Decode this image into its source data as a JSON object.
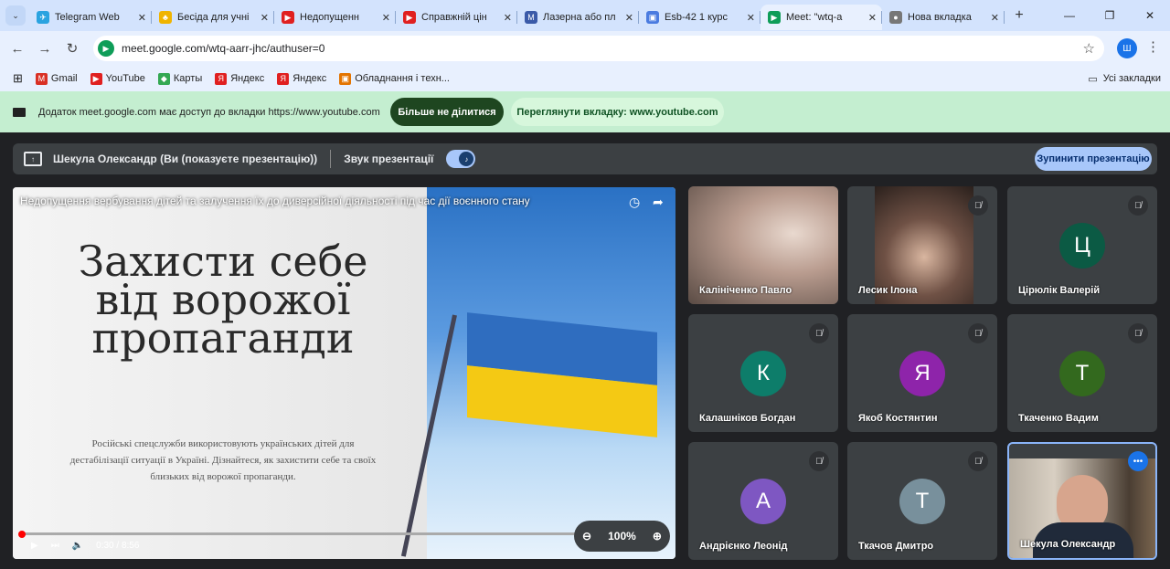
{
  "tabs": [
    {
      "title": "Telegram Web",
      "color": "#2aa3e0",
      "glyph": "✈"
    },
    {
      "title": "Бесіда для учні",
      "color": "#f0b400",
      "glyph": "♣"
    },
    {
      "title": "Недопущенн",
      "color": "#e02020",
      "glyph": "▶"
    },
    {
      "title": "Справжній цін",
      "color": "#e02020",
      "glyph": "▶"
    },
    {
      "title": "Лазерна або пл",
      "color": "#3a5aa8",
      "glyph": "M"
    },
    {
      "title": "Esb-42 1 курс",
      "color": "#4a7be0",
      "glyph": "▣"
    },
    {
      "title": "Meet: \"wtq-a",
      "color": "#0f9d58",
      "glyph": "▶"
    },
    {
      "title": "Нова вкладка",
      "color": "#777777",
      "glyph": "●"
    }
  ],
  "address": {
    "url": "meet.google.com/wtq-aarr-jhc/authuser=0",
    "profile_initial": "Ш"
  },
  "bookmarks": [
    {
      "label": "Gmail",
      "color": "#d93025",
      "glyph": "M"
    },
    {
      "label": "YouTube",
      "color": "#e02020",
      "glyph": "▶"
    },
    {
      "label": "Карты",
      "color": "#34a853",
      "glyph": "◆"
    },
    {
      "label": "Яндекс",
      "color": "#e02020",
      "glyph": "Я"
    },
    {
      "label": "Яндекс",
      "color": "#e02020",
      "glyph": "Я"
    },
    {
      "label": "Обладнання і техн...",
      "color": "#e37400",
      "glyph": "▣"
    }
  ],
  "bookmarks_all": "Усі закладки",
  "infobar": {
    "message": "Додаток meet.google.com має доступ до вкладки https://www.youtube.com",
    "stop_label": "Більше не ділитися",
    "view_label": "Переглянути вкладку: www.youtube.com"
  },
  "presenting": {
    "text": "Шекула Олександр (Ви (показуєте презентацію))",
    "audio_label": "Звук презентації",
    "stop_label": "Зупинити презентацію"
  },
  "video": {
    "title": "Недопущення вербування дітей та залучення їх до диверсійної діяльності під час дії воєнного стану",
    "headline_lines": [
      "Захисти себе",
      "від ворожої",
      "пропаганди"
    ],
    "body_lines": [
      "Російські спецслужби використовують українських дітей для",
      "дестабілізації ситуації в Україні. Дізнайтеся, як захистити себе та своїх",
      "близьких від ворожої пропаганди."
    ],
    "time": "0:30 / 8:56",
    "progress": 0.005,
    "zoom": "100%"
  },
  "participants": [
    {
      "name": "Калініченко Павло",
      "type": "cam1",
      "muted": false
    },
    {
      "name": "Лесик Ілона",
      "type": "cam2",
      "muted": true
    },
    {
      "name": "Цірюлік Валерій",
      "initial": "Ц",
      "color": "#0b5a44",
      "muted": true
    },
    {
      "name": "Калашніков Богдан",
      "initial": "К",
      "color": "#0d7d6a",
      "muted": true
    },
    {
      "name": "Якоб Костянтин",
      "initial": "Я",
      "color": "#8e24aa",
      "muted": true
    },
    {
      "name": "Ткаченко Вадим",
      "initial": "Т",
      "color": "#33691e",
      "muted": true
    },
    {
      "name": "Андрієнко Леонід",
      "initial": "А",
      "color": "#7e57c2",
      "muted": true
    },
    {
      "name": "Ткачов Дмитро",
      "initial": "Т",
      "color": "#78909c",
      "muted": true
    },
    {
      "name": "Шекула Олександр",
      "type": "cam3",
      "muted": false
    }
  ]
}
